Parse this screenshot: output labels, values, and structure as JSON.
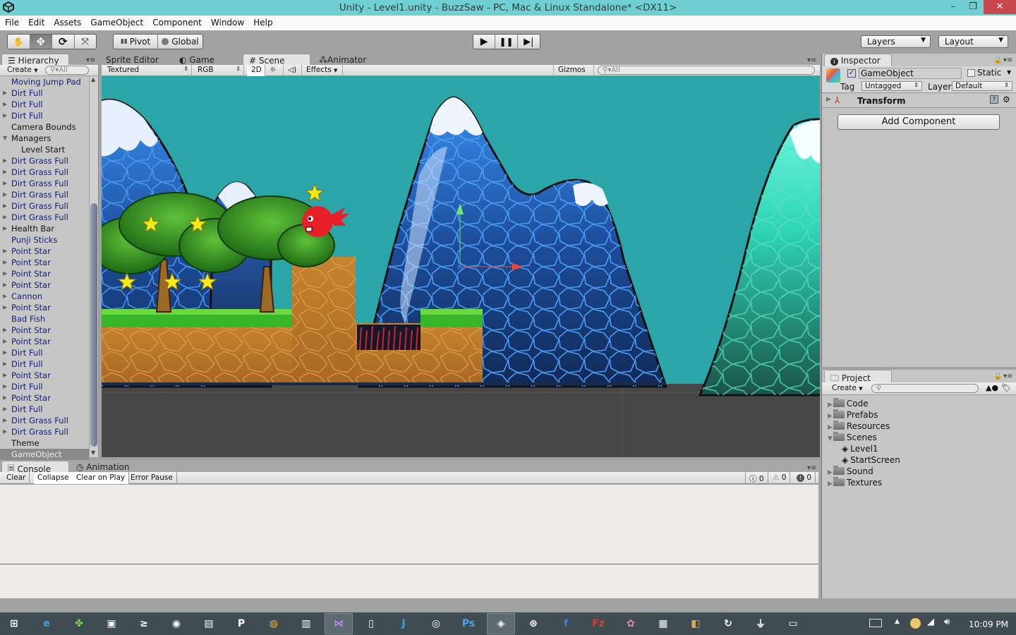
{
  "window": {
    "title": "Unity - Level1.unity - BuzzSaw - PC, Mac & Linux Standalone* <DX11>",
    "minimize": "–",
    "restore": "❐",
    "close": "✕"
  },
  "menu": [
    "File",
    "Edit",
    "Assets",
    "GameObject",
    "Component",
    "Window",
    "Help"
  ],
  "toolbar": {
    "pivot_label": "Pivot",
    "global_label": "Global",
    "layers_label": "Layers",
    "layout_label": "Layout"
  },
  "hierarchy": {
    "tab": "Hierarchy",
    "create": "Create",
    "search_placeholder": "All",
    "items": [
      {
        "label": "Moving Jump Pad",
        "arrow": "",
        "style": "prefab"
      },
      {
        "label": "Dirt Full",
        "arrow": "▶",
        "style": "prefab"
      },
      {
        "label": "Dirt Full",
        "arrow": "▶",
        "style": "prefab"
      },
      {
        "label": "Dirt Full",
        "arrow": "▶",
        "style": "prefab"
      },
      {
        "label": "Camera Bounds",
        "arrow": "",
        "style": "plain"
      },
      {
        "label": "Managers",
        "arrow": "▼",
        "style": "plain"
      },
      {
        "label": "Level Start",
        "arrow": "",
        "style": "plain-sub"
      },
      {
        "label": "Dirt Grass Full",
        "arrow": "▶",
        "style": "prefab"
      },
      {
        "label": "Dirt Grass Full",
        "arrow": "▶",
        "style": "prefab"
      },
      {
        "label": "Dirt Grass Full",
        "arrow": "▶",
        "style": "prefab"
      },
      {
        "label": "Dirt Grass Full",
        "arrow": "▶",
        "style": "prefab"
      },
      {
        "label": "Dirt Grass Full",
        "arrow": "▶",
        "style": "prefab"
      },
      {
        "label": "Dirt Grass Full",
        "arrow": "▶",
        "style": "prefab"
      },
      {
        "label": "Health Bar",
        "arrow": "▶",
        "style": "plain"
      },
      {
        "label": "Punji Sticks",
        "arrow": "",
        "style": "prefab"
      },
      {
        "label": "Point Star",
        "arrow": "▶",
        "style": "prefab"
      },
      {
        "label": "Point Star",
        "arrow": "▶",
        "style": "prefab"
      },
      {
        "label": "Point Star",
        "arrow": "▶",
        "style": "prefab"
      },
      {
        "label": "Point Star",
        "arrow": "▶",
        "style": "prefab"
      },
      {
        "label": "Cannon",
        "arrow": "▶",
        "style": "prefab"
      },
      {
        "label": "Point Star",
        "arrow": "▶",
        "style": "prefab"
      },
      {
        "label": "Bad Fish",
        "arrow": "",
        "style": "prefab"
      },
      {
        "label": "Point Star",
        "arrow": "▶",
        "style": "prefab"
      },
      {
        "label": "Point Star",
        "arrow": "▶",
        "style": "prefab"
      },
      {
        "label": "Dirt Full",
        "arrow": "▶",
        "style": "prefab"
      },
      {
        "label": "Dirt Full",
        "arrow": "▶",
        "style": "prefab"
      },
      {
        "label": "Point Star",
        "arrow": "▶",
        "style": "prefab"
      },
      {
        "label": "Dirt Full",
        "arrow": "▶",
        "style": "prefab"
      },
      {
        "label": "Point Star",
        "arrow": "▶",
        "style": "prefab"
      },
      {
        "label": "Dirt Full",
        "arrow": "▶",
        "style": "prefab"
      },
      {
        "label": "Dirt Grass Full",
        "arrow": "▶",
        "style": "prefab"
      },
      {
        "label": "Dirt Grass Full",
        "arrow": "▶",
        "style": "prefab"
      },
      {
        "label": "Theme",
        "arrow": "",
        "style": "plain"
      },
      {
        "label": "GameObject",
        "arrow": "",
        "style": "selected"
      }
    ]
  },
  "scene": {
    "tabs": [
      {
        "label": "Sprite Editor",
        "icon": ""
      },
      {
        "label": "Game",
        "icon": "◐"
      },
      {
        "label": "Scene",
        "icon": "#"
      },
      {
        "label": "Animator",
        "icon": "⁂"
      }
    ],
    "active_tab": "Scene",
    "render_mode": "Textured",
    "color_mode": "RGB",
    "mode_2d": "2D",
    "effects": "Effects",
    "gizmos": "Gizmos",
    "search_placeholder": "All",
    "sky_color": "#2aa6a9"
  },
  "inspector": {
    "tab": "Inspector",
    "object_name": "GameObject",
    "active_checked": true,
    "static_label": "Static",
    "static_checked": false,
    "tag_label": "Tag",
    "tag_value": "Untagged",
    "layer_label": "Layer",
    "layer_value": "Default",
    "component": "Transform",
    "add_component": "Add Component"
  },
  "project": {
    "tab": "Project",
    "create": "Create",
    "items": [
      {
        "label": "Code",
        "type": "folder",
        "arrow": "▶"
      },
      {
        "label": "Prefabs",
        "type": "folder",
        "arrow": "▶"
      },
      {
        "label": "Resources",
        "type": "folder",
        "arrow": "▶"
      },
      {
        "label": "Scenes",
        "type": "folder",
        "arrow": "▼"
      },
      {
        "label": "Level1",
        "type": "scene",
        "arrow": ""
      },
      {
        "label": "StartScreen",
        "type": "scene",
        "arrow": ""
      },
      {
        "label": "Sound",
        "type": "folder",
        "arrow": "▶"
      },
      {
        "label": "Textures",
        "type": "folder",
        "arrow": "▶"
      }
    ]
  },
  "console": {
    "tabs": [
      "Console",
      "Animation"
    ],
    "buttons": [
      {
        "label": "Clear",
        "on": false
      },
      {
        "label": "Collapse",
        "on": true
      },
      {
        "label": "Clear on Play",
        "on": true
      },
      {
        "label": "Error Pause",
        "on": false
      }
    ],
    "info_count": "0",
    "warning_count": "0",
    "error_count": "0"
  },
  "taskbar": {
    "apps": [
      "windows-start",
      "internet-explorer",
      "clover",
      "remote-desktop",
      "powershell",
      "steam",
      "file-manager",
      "p-app",
      "chrome",
      "calibre",
      "visual-studio",
      "notepad",
      "jetbrains",
      "screen-capture",
      "photoshop",
      "unity",
      "app-circles",
      "facebook",
      "filezilla",
      "app-pink",
      "app-dark",
      "app-box",
      "app-swirl",
      "app-usb",
      "app-window"
    ],
    "active": [
      "visual-studio",
      "unity"
    ],
    "clock": "10:09 PM"
  }
}
